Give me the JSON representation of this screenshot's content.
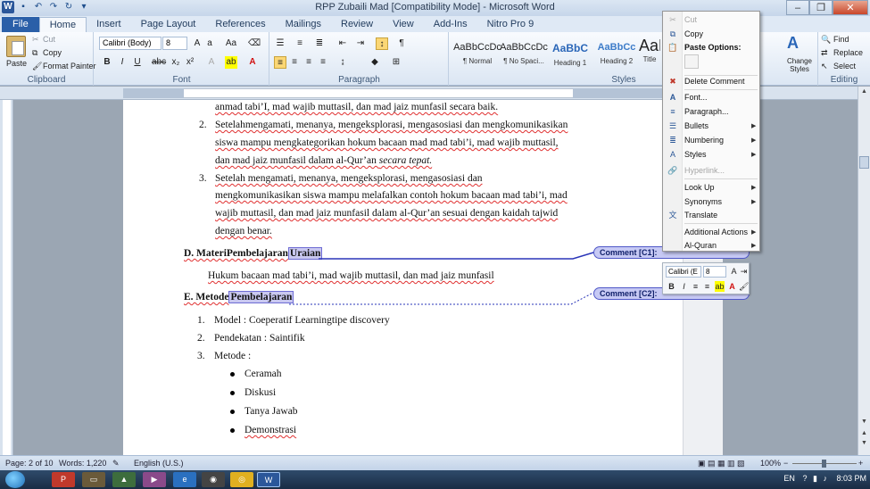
{
  "window": {
    "title": "RPP Zubaili Mad [Compatibility Mode] - Microsoft Word",
    "app_icon": "W"
  },
  "tabs": [
    "File",
    "Home",
    "Insert",
    "Page Layout",
    "References",
    "Mailings",
    "Review",
    "View",
    "Add-Ins",
    "Nitro Pro 9"
  ],
  "ribbon": {
    "clipboard": {
      "label": "Clipboard",
      "paste": "Paste",
      "cut": "Cut",
      "copy": "Copy",
      "format_painter": "Format Painter"
    },
    "font": {
      "label": "Font",
      "name": "Calibri (Body)",
      "size": "8"
    },
    "paragraph": {
      "label": "Paragraph"
    },
    "styles": {
      "label": "Styles",
      "items": [
        {
          "sample": "AaBbCcDc",
          "name": "¶ Normal"
        },
        {
          "sample": "AaBbCcDc",
          "name": "¶ No Spaci..."
        },
        {
          "sample": "AaBbC",
          "name": "Heading 1"
        },
        {
          "sample": "AaBbCc",
          "name": "Heading 2"
        },
        {
          "sample": "AaB",
          "name": "Title"
        }
      ],
      "change_styles": "Change Styles"
    },
    "editing": {
      "label": "Editing",
      "find": "Find",
      "replace": "Replace",
      "select": "Select"
    }
  },
  "document": {
    "line1": "anmad tabi’I, mad wajib muttasil, dan mad jaiz munfasil secara baik.",
    "item2": {
      "num": "2.",
      "l1": "Setelahmengamati, menanya, mengeksplorasi, mengasosiasi dan mengkomunikasikan",
      "l2": "siswa mampu mengkategorikan hokum bacaan mad mad tabi’i, mad wajib muttasil,",
      "l3a": "dan mad jaiz munfasil dalam al-Qur’an ",
      "l3b": "secara tepat."
    },
    "item3": {
      "num": "3.",
      "l1": "Setelah mengamati, menanya, mengeksplorasi, mengasosiasi dan",
      "l2": "mengkomunikasikan siswa mampu melafalkan contoh hokum bacaan mad tabi’i, mad",
      "l3": "wajib muttasil, dan mad jaiz munfasil dalam al-Qur’an sesuai dengan kaidah tajwid",
      "l4": "dengan benar."
    },
    "headingD": {
      "prefix": "D. MateriPembelajaran",
      "highlight": "Uraian"
    },
    "hukum": "Hukum bacaan mad tabi’i, mad wajib muttasil, dan mad jaiz munfasil",
    "headingE": {
      "prefix": "E. Metode",
      "highlight": "Pembelajaran"
    },
    "list": [
      {
        "num": "1.",
        "text": "Model  : Coeperatif Learningtipe discovery"
      },
      {
        "num": "2.",
        "text": "Pendekatan : Saintifik"
      },
      {
        "num": "3.",
        "text": "Metode       :"
      }
    ],
    "bullets": [
      "Ceramah",
      "Diskusi",
      "Tanya Jawab",
      "Demonstrasi"
    ]
  },
  "comments": [
    {
      "label": "Comment [C1]:"
    },
    {
      "label": "Comment [C2]:"
    }
  ],
  "context_menu": {
    "cut": "Cut",
    "copy": "Copy",
    "paste_options": "Paste Options:",
    "delete_comment": "Delete Comment",
    "font": "Font...",
    "paragraph": "Paragraph...",
    "bullets": "Bullets",
    "numbering": "Numbering",
    "styles": "Styles",
    "hyperlink": "Hyperlink...",
    "look_up": "Look Up",
    "synonyms": "Synonyms",
    "translate": "Translate",
    "additional_actions": "Additional Actions",
    "al_quran": "Al-Quran"
  },
  "mini_toolbar": {
    "font": "Calibri (E",
    "size": "8"
  },
  "statusbar": {
    "page": "Page: 2 of 10",
    "words": "Words: 1,220",
    "language": "English (U.S.)",
    "zoom": "100%"
  },
  "taskbar": {
    "lang": "EN",
    "time": "8:03 PM"
  },
  "colors": {
    "accent": "#2b579a",
    "comment_fill": "#c6c9f4",
    "comment_border": "#5058c8"
  }
}
